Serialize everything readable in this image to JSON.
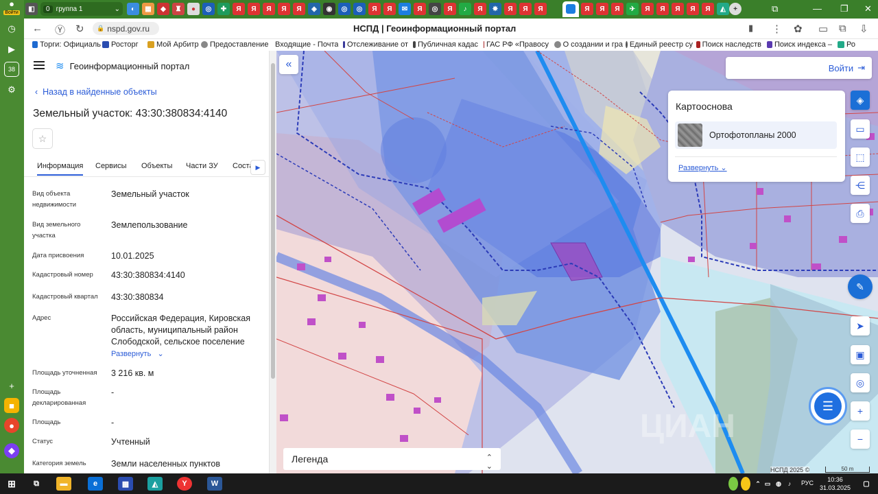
{
  "browser": {
    "login_label": "Войти",
    "tab_group_count": "0",
    "tab_group_name": "группа 1",
    "url": "nspd.gov.ru",
    "page_title": "НСПД | Геоинформационный портал",
    "sidebar_badge": "38",
    "bookmarks": [
      "Торги: Официаль",
      "Росторг",
      "Мой Арбитр",
      "Предоставление",
      "Входящие - Почта",
      "Отслеживание от",
      "Публичная кадас",
      "ГАС РФ «Правосу",
      "О создании и гра",
      "Единый реестр су",
      "Поиск наследств",
      "Поиск индекса –",
      "Ро"
    ]
  },
  "panel": {
    "portal_title": "Геоинформационный портал",
    "back_link": "Назад в найденные объекты",
    "object_title": "Земельный участок: 43:30:380834:4140",
    "tabs": [
      "Информация",
      "Сервисы",
      "Объекты",
      "Части ЗУ",
      "Соста"
    ],
    "fields": [
      {
        "key": "Вид объекта недвижимости",
        "value": "Земельный участок"
      },
      {
        "key": "Вид земельного участка",
        "value": "Землепользование"
      },
      {
        "key": "Дата присвоения",
        "value": "10.01.2025"
      },
      {
        "key": "Кадастровый номер",
        "value": "43:30:380834:4140"
      },
      {
        "key": "Кадастровый квартал",
        "value": "43:30:380834"
      },
      {
        "key": "Адрес",
        "value": "Российская Федерация, Кировская область, муниципальный район Слободской, сельское поселение"
      },
      {
        "key": "Площадь уточненная",
        "value": "3 216 кв. м"
      },
      {
        "key": "Площадь декларированная",
        "value": "-"
      },
      {
        "key": "Площадь",
        "value": "-"
      },
      {
        "key": "Статус",
        "value": "Учтенный"
      },
      {
        "key": "Категория земель",
        "value": "Земли населенных пунктов"
      }
    ],
    "expand_label": "Развернуть"
  },
  "map": {
    "login": "Войти",
    "basemap_title": "Картооснова",
    "basemap_item": "Ортофотопланы 2000",
    "basemap_expand": "Развернуть",
    "legend": "Легенда",
    "copyright": "НСПД 2025 ©",
    "scale": "50 m",
    "watermark": "ЦИАН"
  },
  "taskbar": {
    "lang": "РУС",
    "time": "10:36",
    "date": "31.03.2025"
  },
  "colors": {
    "accent": "#2a5bd7",
    "zone_blue": "#5b7fe0",
    "parcel_red": "#d24545",
    "building_magenta": "#c050c8",
    "road_blue": "#1e8cf0"
  }
}
